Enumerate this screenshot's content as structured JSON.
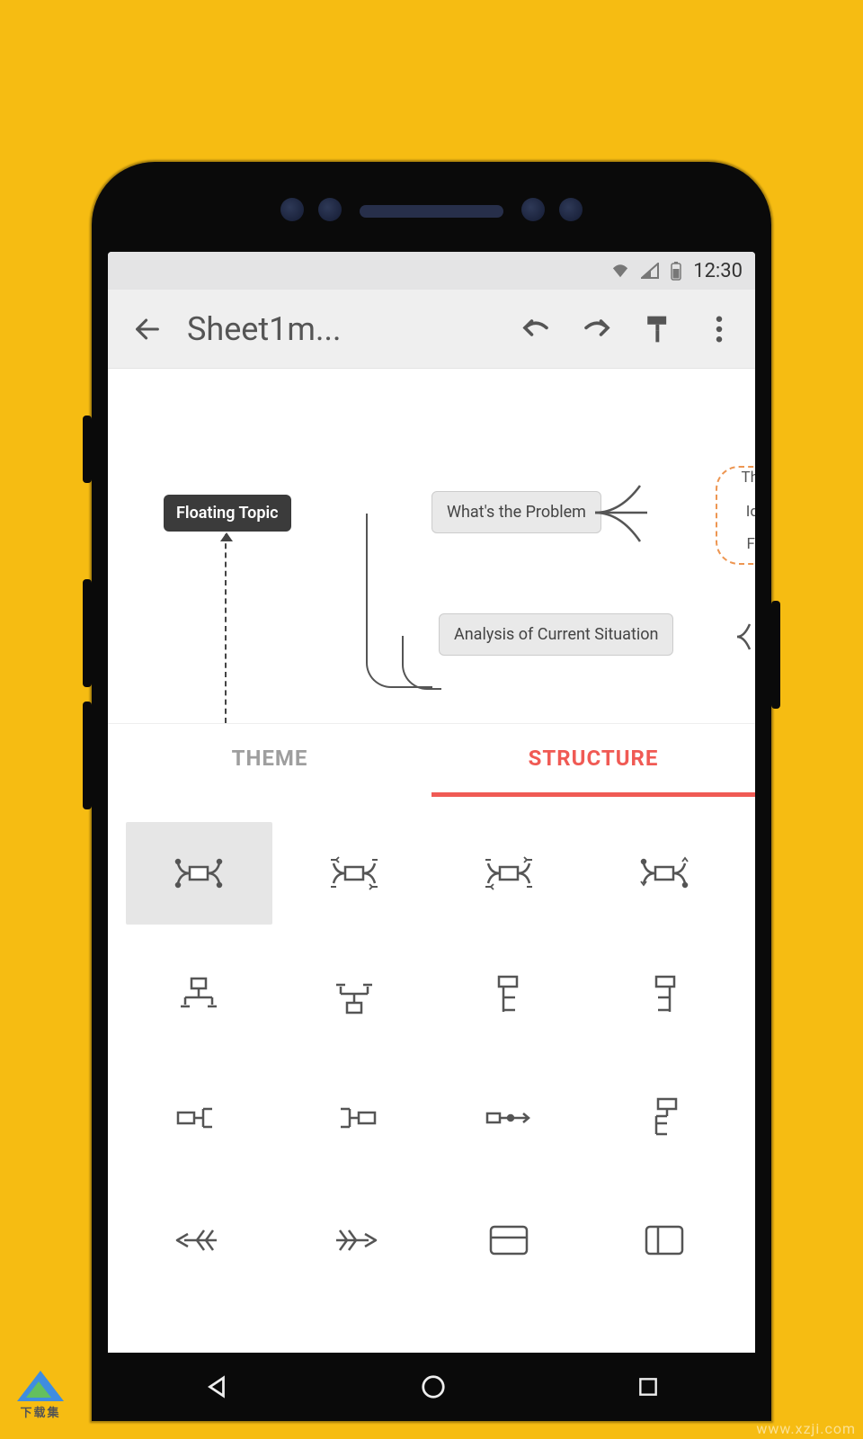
{
  "status": {
    "time": "12:30"
  },
  "toolbar": {
    "title": "Sheet1m..."
  },
  "canvas": {
    "floating_topic": "Floating Topic",
    "node1": "What's the Problem",
    "node2": "Analysis of Current Situation",
    "clip1": "Th",
    "clip2": "Id",
    "clip3": "Fi"
  },
  "tabs": {
    "theme": "THEME",
    "structure": "STRUCTURE"
  },
  "watermark": {
    "left_text": "下载集",
    "right_text": "www.xzji.com"
  }
}
